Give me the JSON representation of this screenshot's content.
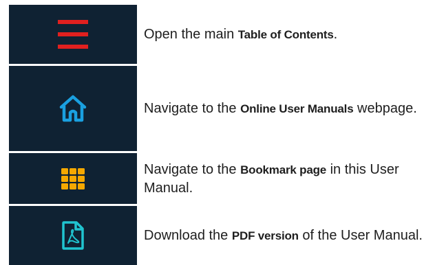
{
  "rows": [
    {
      "icon": "menu-hamburger-icon",
      "icon_color": "#e0201f",
      "text_before": "Open the main ",
      "text_bold": "Table of Contents",
      "text_after": "."
    },
    {
      "icon": "home-icon",
      "icon_color": "#1aa0e0",
      "text_before": "Navigate to the ",
      "text_bold": "Online User Manuals",
      "text_after": " webpage."
    },
    {
      "icon": "grid-icon",
      "icon_color": "#f5a800",
      "text_before": "Navigate to the ",
      "text_bold": "Bookmark page",
      "text_after": " in this User Manual."
    },
    {
      "icon": "pdf-file-icon",
      "icon_color": "#20c4d0",
      "text_before": "Download the ",
      "text_bold": "PDF version",
      "text_after": " of the User Manual."
    }
  ],
  "colors": {
    "tile_background": "#0f2233",
    "text": "#1e1e1e"
  }
}
